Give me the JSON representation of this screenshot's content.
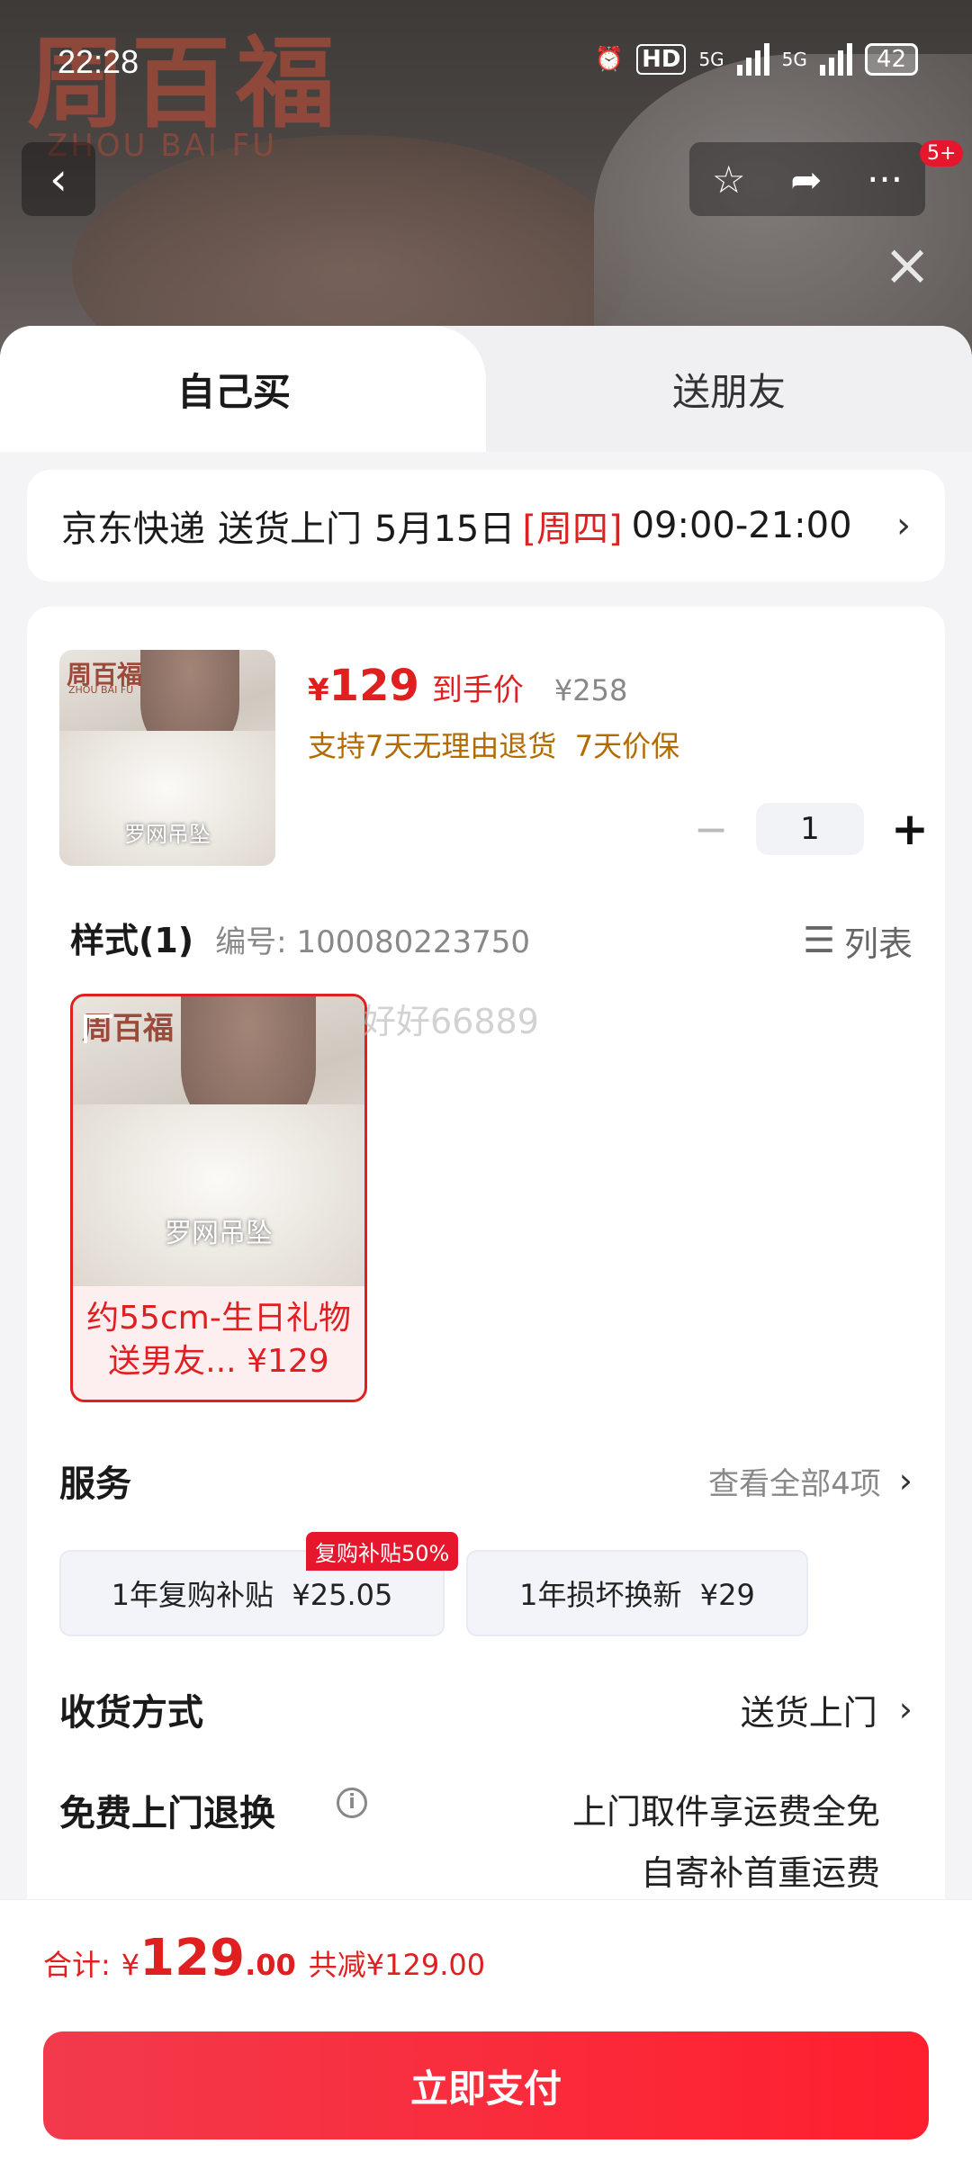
{
  "status_bar": {
    "time": "22:28",
    "hd": "HD",
    "net1": "5G",
    "net2": "5G",
    "battery": "42"
  },
  "hero": {
    "brand": "周百福",
    "brand_en": "ZHOU BAI FU",
    "badge": "5+"
  },
  "tabs": [
    {
      "label": "自己买",
      "selected": true
    },
    {
      "label": "送朋友",
      "selected": false
    }
  ],
  "delivery": {
    "carrier": "京东快递",
    "method": "送货上门",
    "date": "5月15日",
    "weekday": "[周四]",
    "window": "09:00-21:00"
  },
  "product": {
    "thumb_caption": "罗网吊坠",
    "price_symbol": "¥",
    "price": "129",
    "price_tag": "到手价",
    "original_price": "¥258",
    "policy": "支持7天无理由退货  7天价保",
    "quantity": "1"
  },
  "style": {
    "title": "样式(1)",
    "code": "编号: 100080223750",
    "list_label": "列表",
    "variant_caption": "罗网吊坠",
    "variant_label_1": "约55cm-生日礼物",
    "variant_label_2": "送男友... ¥129",
    "watermark": "好好66889"
  },
  "services": {
    "title": "服务",
    "view_all": "查看全部4项",
    "chip1": "1年复购补贴  ¥25.05",
    "chip1_badge": "复购补贴50%",
    "chip2": "1年损坏换新  ¥29"
  },
  "shipping": {
    "title": "收货方式",
    "value": "送货上门"
  },
  "returns": {
    "title": "免费上门退换",
    "line1": "上门取件享运费全免",
    "line2": "自寄补首重运费"
  },
  "footer": {
    "total_label": "合计:",
    "total_yen": "¥",
    "total_int": "129",
    "total_dec": ".00",
    "discount": "共减¥129.00",
    "pay_button": "立即支付"
  },
  "colors": {
    "accent_red": "#e02020",
    "policy_orange": "#b36b00",
    "pay_button": "#ff1f2e"
  }
}
